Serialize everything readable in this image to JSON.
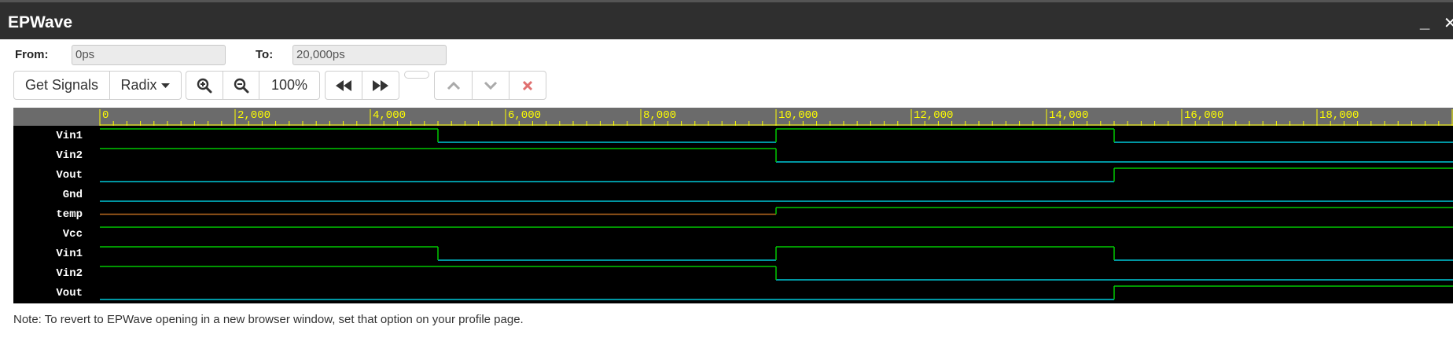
{
  "window": {
    "title": "EPWave"
  },
  "range": {
    "from_label": "From:",
    "from_value": "0ps",
    "to_label": "To:",
    "to_value": "20,000ps"
  },
  "toolbar": {
    "get_signals": "Get Signals",
    "radix": "Radix",
    "zoom_level": "100%"
  },
  "ruler": {
    "ticks": [
      "0",
      "2,000",
      "4,000",
      "6,000",
      "8,000",
      "10,000",
      "12,000",
      "14,000",
      "16,000",
      "18,000"
    ]
  },
  "signals": [
    {
      "name": "Vin1",
      "values": [
        [
          0,
          1
        ],
        [
          5000,
          0
        ],
        [
          10000,
          1
        ],
        [
          15000,
          0
        ]
      ]
    },
    {
      "name": "Vin2",
      "values": [
        [
          0,
          1
        ],
        [
          10000,
          0
        ]
      ]
    },
    {
      "name": "Vout",
      "values": [
        [
          0,
          0
        ],
        [
          15000,
          1
        ]
      ]
    },
    {
      "name": "Gnd",
      "values": [
        [
          0,
          0
        ]
      ]
    },
    {
      "name": "temp",
      "values": [
        [
          0,
          "x"
        ],
        [
          10000,
          1
        ]
      ]
    },
    {
      "name": "Vcc",
      "values": [
        [
          0,
          1
        ]
      ]
    },
    {
      "name": "Vin1",
      "values": [
        [
          0,
          1
        ],
        [
          5000,
          0
        ],
        [
          10000,
          1
        ],
        [
          15000,
          0
        ]
      ]
    },
    {
      "name": "Vin2",
      "values": [
        [
          0,
          1
        ],
        [
          10000,
          0
        ]
      ]
    },
    {
      "name": "Vout",
      "values": [
        [
          0,
          0
        ],
        [
          15000,
          1
        ]
      ]
    }
  ],
  "time_range_ps": [
    0,
    20000
  ],
  "colors": {
    "high": "#00c800",
    "low": "#00c8d8",
    "x": "#b86a1e",
    "ruler_text": "#ffff00"
  },
  "note": "Note: To revert to EPWave opening in a new browser window, set that option on your profile page."
}
